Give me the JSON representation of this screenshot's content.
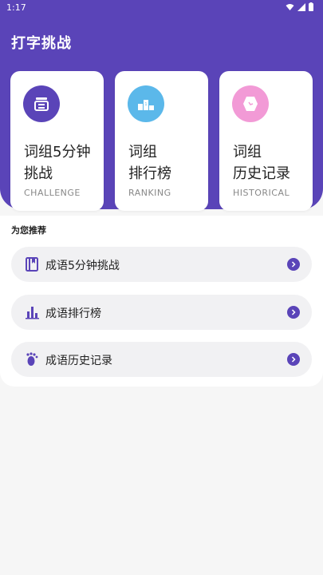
{
  "status_bar": {
    "time": "1:17"
  },
  "app": {
    "title": "打字挑战"
  },
  "cards": [
    {
      "title_line1": "词组5分钟",
      "title_line2": "挑战",
      "subtitle": "CHALLENGE",
      "icon": "scale-icon",
      "color": "#5a44b8"
    },
    {
      "title_line1": "词组",
      "title_line2": "排行榜",
      "subtitle": "RANKING",
      "icon": "podium-icon",
      "color": "#5bb8ea"
    },
    {
      "title_line1": "词组",
      "title_line2": "历史记录",
      "subtitle": "HISTORICAL",
      "icon": "clock-icon",
      "color": "#f29ad6"
    }
  ],
  "recommend": {
    "section_label": "为您推荐",
    "items": [
      {
        "label": "成语5分钟挑战",
        "icon": "book-icon"
      },
      {
        "label": "成语排行榜",
        "icon": "bar-chart-icon"
      },
      {
        "label": "成语历史记录",
        "icon": "footprint-icon"
      }
    ]
  },
  "colors": {
    "primary": "#5a44b8",
    "background": "#f6f6f6"
  }
}
